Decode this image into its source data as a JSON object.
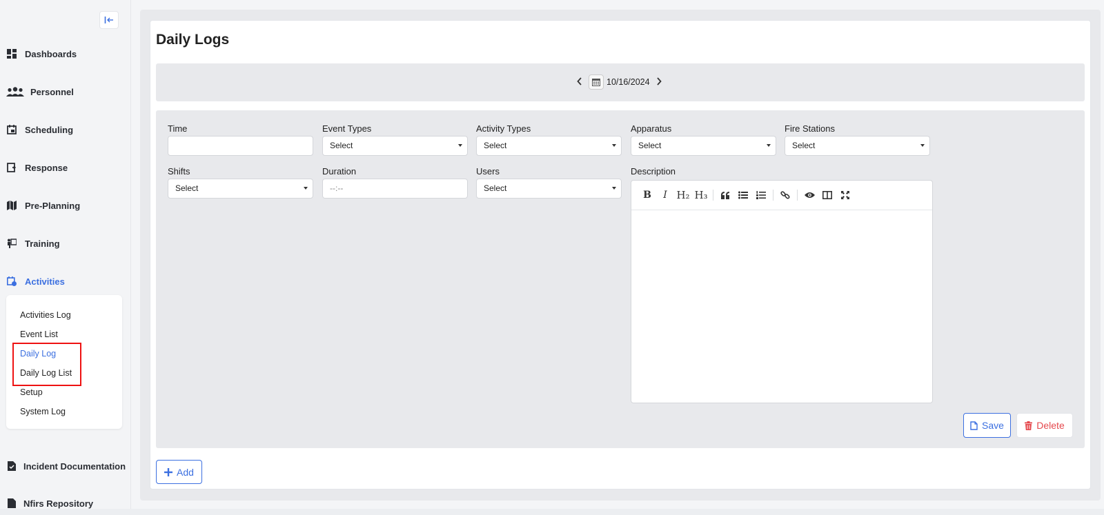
{
  "sidebar": {
    "nav": [
      {
        "label": "Dashboards",
        "icon": "dashboard-icon"
      },
      {
        "label": "Personnel",
        "icon": "people-icon"
      },
      {
        "label": "Scheduling",
        "icon": "calendar-icon"
      },
      {
        "label": "Response",
        "icon": "response-icon"
      },
      {
        "label": "Pre-Planning",
        "icon": "map-icon"
      },
      {
        "label": "Training",
        "icon": "training-icon"
      },
      {
        "label": "Activities",
        "icon": "activities-icon"
      },
      {
        "label": "Incident Documentation",
        "icon": "document-icon"
      },
      {
        "label": "Nfirs Repository",
        "icon": "repository-icon"
      }
    ],
    "submenu": [
      "Activities Log",
      "Event List",
      "Daily Log",
      "Daily Log List",
      "Setup",
      "System Log"
    ],
    "active_nav": "Activities",
    "active_sub": "Daily Log"
  },
  "page": {
    "title": "Daily Logs",
    "date": "10/16/2024"
  },
  "form": {
    "time_label": "Time",
    "time_value": "",
    "event_types_label": "Event Types",
    "event_types_value": "Select",
    "activity_types_label": "Activity Types",
    "activity_types_value": "Select",
    "apparatus_label": "Apparatus",
    "apparatus_value": "Select",
    "fire_stations_label": "Fire Stations",
    "fire_stations_value": "Select",
    "shifts_label": "Shifts",
    "shifts_value": "Select",
    "duration_label": "Duration",
    "duration_placeholder": "--:--",
    "users_label": "Users",
    "users_value": "Select",
    "description_label": "Description"
  },
  "editor_toolbar": [
    "B",
    "I",
    "H₂",
    "H₃"
  ],
  "buttons": {
    "save": "Save",
    "delete": "Delete",
    "add": "Add"
  },
  "colors": {
    "accent": "#3b6fe0",
    "danger": "#e5484d",
    "highlight": "#e11111"
  }
}
